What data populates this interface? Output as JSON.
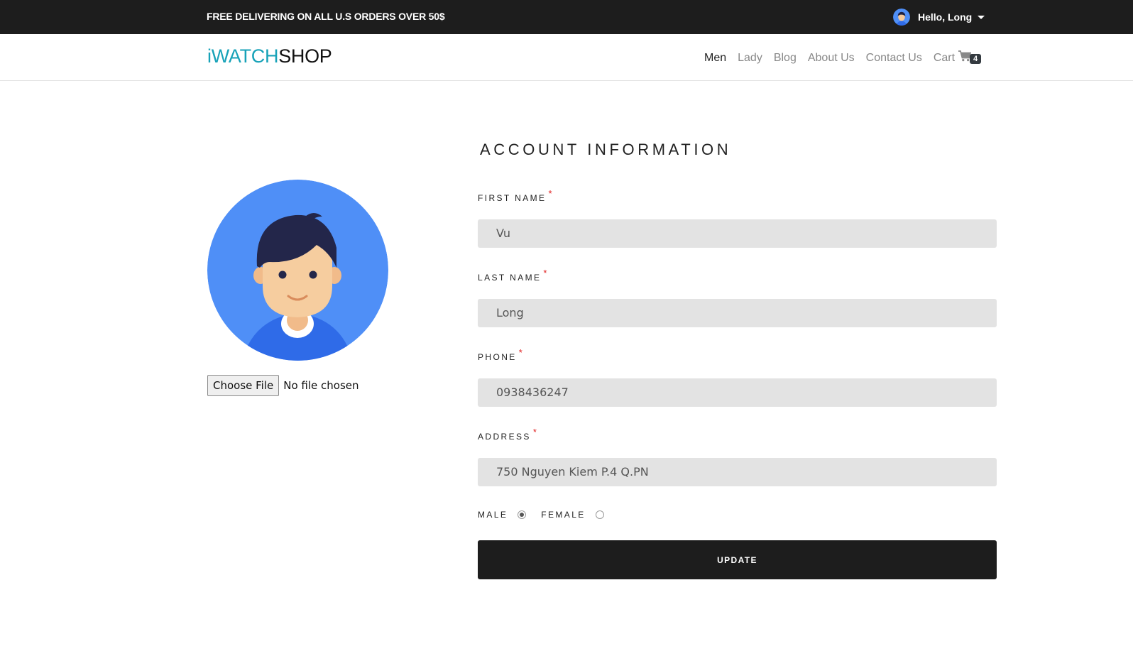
{
  "topbar": {
    "promo": "FREE DELIVERING ON ALL U.S ORDERS OVER 50$",
    "greeting": "Hello, Long"
  },
  "navbar": {
    "logo_part1": "iWATCH",
    "logo_part2": "SHOP",
    "links": [
      "Men",
      "Lady",
      "Blog",
      "About Us",
      "Contact Us"
    ],
    "active": "Men",
    "cart_label": "Cart",
    "cart_count": "4"
  },
  "profile": {
    "file_button": "Choose File",
    "file_status": "No file chosen"
  },
  "form": {
    "title": "ACCOUNT INFORMATION",
    "required_mark": "*",
    "first_name_label": "FIRST NAME",
    "first_name_value": "Vu",
    "last_name_label": "LAST NAME",
    "last_name_value": "Long",
    "phone_label": "PHONE",
    "phone_value": "0938436247",
    "address_label": "ADDRESS",
    "address_value": "750 Nguyen Kiem P.4 Q.PN",
    "male_label": "MALE",
    "female_label": "FEMALE",
    "gender_selected": "male",
    "update_label": "UPDATE"
  },
  "colors": {
    "topbar_bg": "#1d1d1d",
    "logo_accent": "#17a2b8",
    "input_bg": "#e3e3e3",
    "required": "#e02020",
    "avatar_bg": "#4f8ff7"
  }
}
